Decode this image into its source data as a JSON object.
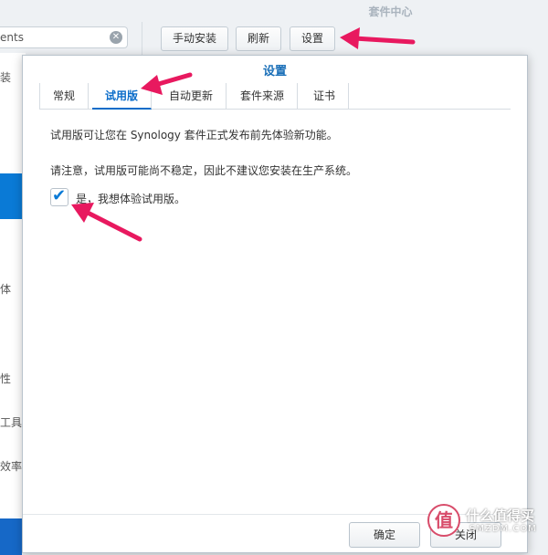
{
  "app": {
    "title": "套件中心"
  },
  "search": {
    "value": "ents",
    "clear_icon": "close-circle-icon"
  },
  "sidebar": {
    "items": [
      {
        "label": "装"
      },
      {
        "label": "体"
      },
      {
        "label": "性"
      },
      {
        "label": "工具"
      },
      {
        "label": "效率"
      }
    ]
  },
  "toolbar": {
    "manual_install": "手动安装",
    "refresh": "刷新",
    "settings": "设置"
  },
  "dialog": {
    "title": "设置",
    "tabs": [
      {
        "label": "常规"
      },
      {
        "label": "试用版",
        "active": true
      },
      {
        "label": "自动更新"
      },
      {
        "label": "套件来源"
      },
      {
        "label": "证书"
      }
    ],
    "description_1": "试用版可让您在 Synology 套件正式发布前先体验新功能。",
    "description_2": "请注意，试用版可能尚不稳定，因此不建议您安装在生产系统。",
    "checkbox": {
      "label": "是，我想体验试用版。",
      "checked": true
    },
    "ok_label": "确定",
    "close_label": "关闭"
  },
  "watermark": {
    "logo": "值",
    "text": "什么值得买",
    "sub": "SMZDM.COM"
  },
  "colors": {
    "accent": "#0a7ad6",
    "arrow": "#e8195f",
    "title": "#1a6fb8"
  }
}
